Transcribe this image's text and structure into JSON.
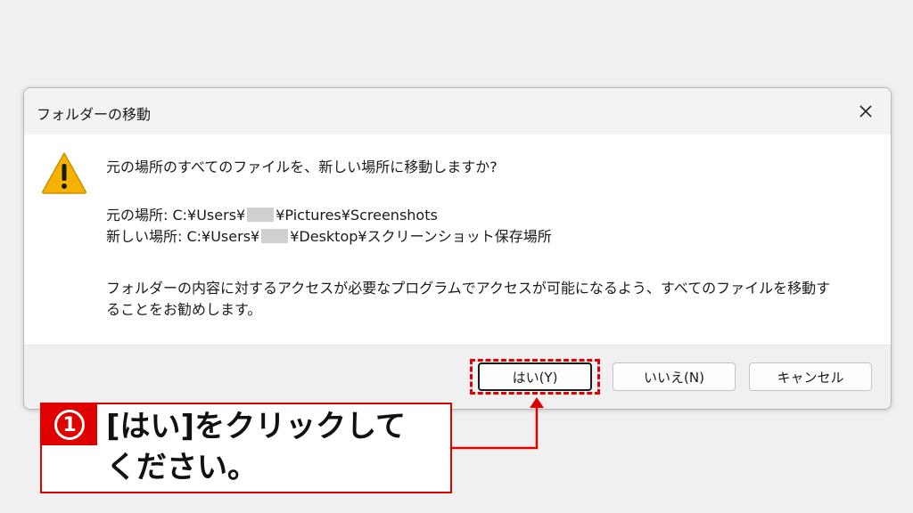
{
  "dialog": {
    "title": "フォルダーの移動",
    "question": "元の場所のすべてのファイルを、新しい場所に移動しますか?",
    "from": {
      "prefix": "元の場所: C:¥Users¥",
      "suffix": "¥Pictures¥Screenshots"
    },
    "to": {
      "prefix": "新しい場所: C:¥Users¥",
      "suffix": "¥Desktop¥スクリーンショット保存場所"
    },
    "note_line1": "フォルダーの内容に対するアクセスが必要なプログラムでアクセスが可能になるよう、すべてのファイルを移動す",
    "note_line2": "ることをお勧めします。",
    "buttons": {
      "yes": "はい(Y)",
      "no": "いいえ(N)",
      "cancel": "キャンセル"
    }
  },
  "callout": {
    "step": "1",
    "line1": "[はい]をクリックして",
    "line2": "ください。"
  },
  "colors": {
    "accent_red": "#e00000",
    "warning_yellow": "#f5b300"
  }
}
